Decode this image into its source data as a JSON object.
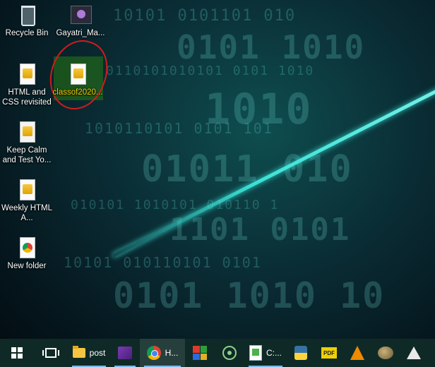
{
  "desktop": {
    "icons": [
      {
        "label": "Recycle Bin"
      },
      {
        "label": "Gayatri_Ma..."
      },
      {
        "label": "HTML and CSS revisited"
      },
      {
        "label": "classof2020..."
      },
      {
        "label": "Keep Calm and Test Yo..."
      },
      {
        "label": "Weekly HTML A..."
      },
      {
        "label": "New folder"
      }
    ]
  },
  "taskbar": {
    "items": [
      {
        "icon": "windows-start-icon"
      },
      {
        "icon": "task-view-icon"
      },
      {
        "icon": "folder-icon",
        "label": "post"
      },
      {
        "icon": "ebook-icon"
      },
      {
        "icon": "chrome-icon",
        "label": "H..."
      },
      {
        "icon": "tiles-app-icon"
      },
      {
        "icon": "atom-icon"
      },
      {
        "icon": "notepad-icon",
        "label": "C:..."
      },
      {
        "icon": "python-icon"
      },
      {
        "icon": "pdf-icon",
        "label_glyph": "PDF"
      },
      {
        "icon": "vlc-icon"
      },
      {
        "icon": "gimp-icon"
      },
      {
        "icon": "inkscape-icon"
      }
    ]
  },
  "colors": {
    "annotation_circle": "#d01c1c",
    "selection": "#2d7814",
    "selected_label": "#f5d000",
    "taskbar": "#0f2a26"
  }
}
